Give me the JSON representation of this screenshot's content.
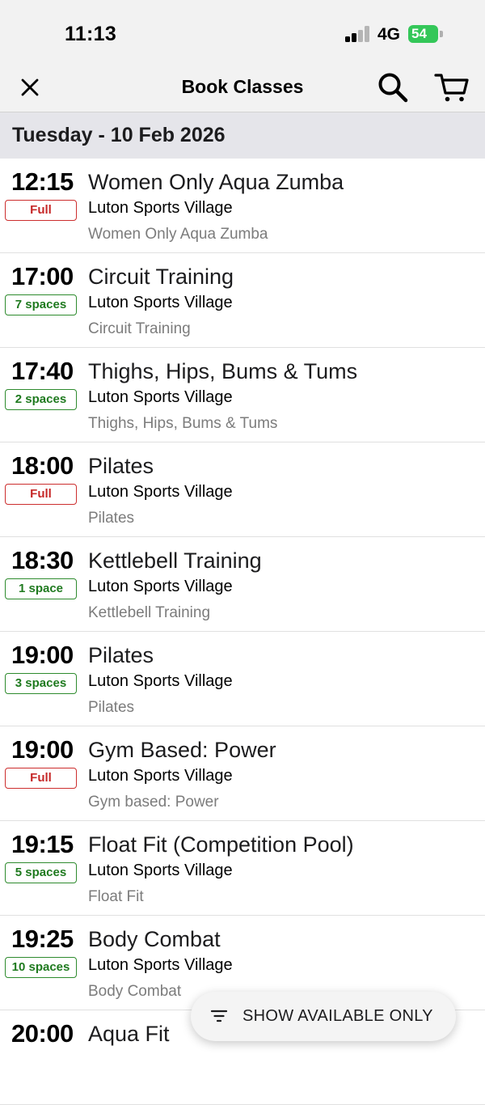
{
  "status_bar": {
    "time": "11:13",
    "network": "4G",
    "battery": "54"
  },
  "nav": {
    "title": "Book Classes",
    "close_icon": "close-icon",
    "search_icon": "search-icon",
    "cart_icon": "cart-icon"
  },
  "date_header": "Tuesday - 10 Feb 2026",
  "colors": {
    "full": "#c62828",
    "available": "#1f7a1f",
    "header_bg": "#e5e5ea"
  },
  "classes": [
    {
      "time": "12:15",
      "status": "Full",
      "status_type": "full",
      "name": "Women Only Aqua Zumba",
      "venue": "Luton Sports Village",
      "description": "Women Only Aqua Zumba"
    },
    {
      "time": "17:00",
      "status": "7 spaces",
      "status_type": "available",
      "name": "Circuit Training",
      "venue": "Luton Sports Village",
      "description": "Circuit Training"
    },
    {
      "time": "17:40",
      "status": "2 spaces",
      "status_type": "available",
      "name": "Thighs, Hips, Bums & Tums",
      "venue": "Luton Sports Village",
      "description": "Thighs, Hips, Bums & Tums"
    },
    {
      "time": "18:00",
      "status": "Full",
      "status_type": "full",
      "name": "Pilates",
      "venue": "Luton Sports Village",
      "description": "Pilates"
    },
    {
      "time": "18:30",
      "status": "1 space",
      "status_type": "available",
      "name": "Kettlebell Training",
      "venue": "Luton Sports Village",
      "description": "Kettlebell Training"
    },
    {
      "time": "19:00",
      "status": "3 spaces",
      "status_type": "available",
      "name": "Pilates",
      "venue": "Luton Sports Village",
      "description": "Pilates"
    },
    {
      "time": "19:00",
      "status": "Full",
      "status_type": "full",
      "name": "Gym Based: Power",
      "venue": "Luton Sports Village",
      "description": "Gym based: Power"
    },
    {
      "time": "19:15",
      "status": "5 spaces",
      "status_type": "available",
      "name": "Float Fit (Competition Pool)",
      "venue": "Luton Sports Village",
      "description": "Float Fit"
    },
    {
      "time": "19:25",
      "status": "10 spaces",
      "status_type": "available",
      "name": "Body Combat",
      "venue": "Luton Sports Village",
      "description": "Body Combat"
    },
    {
      "time": "20:00",
      "name": "Aqua Fit"
    }
  ],
  "filter_button": {
    "label": "SHOW AVAILABLE ONLY",
    "icon": "filter-icon"
  }
}
